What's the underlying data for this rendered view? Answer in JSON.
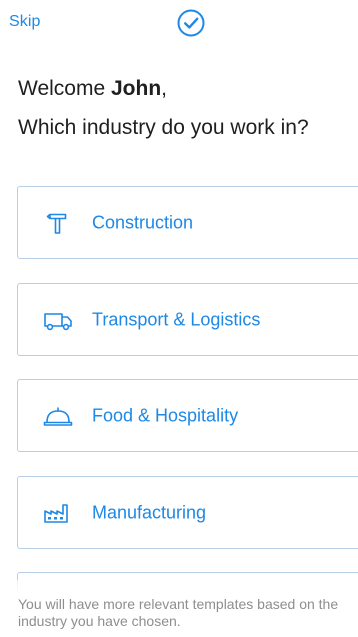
{
  "header": {
    "skip_label": "Skip",
    "check_icon": "check-circle-icon",
    "accent_color": "#1e88e5"
  },
  "greeting": {
    "welcome_prefix": "Welcome ",
    "user_name": "John",
    "welcome_suffix": ",",
    "question": "Which industry do you work in?"
  },
  "industries": [
    {
      "label": "Construction",
      "icon": "hammer-icon"
    },
    {
      "label": "Transport & Logistics",
      "icon": "truck-icon"
    },
    {
      "label": "Food & Hospitality",
      "icon": "cloche-icon"
    },
    {
      "label": "Manufacturing",
      "icon": "factory-icon"
    },
    {
      "label": "",
      "icon": ""
    }
  ],
  "footer": {
    "note": "You will have more relevant templates based on the industry you have chosen."
  }
}
